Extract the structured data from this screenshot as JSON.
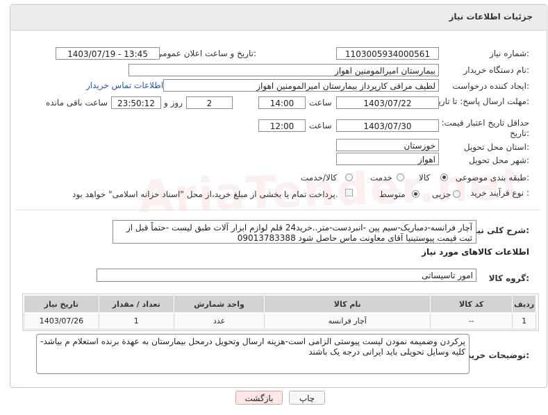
{
  "header": {
    "title": "جزئیات اطلاعات نیاز"
  },
  "watermark": "AriaTender.net",
  "fields": {
    "need_number_label": "شماره نیاز:",
    "need_number": "1103005934000561",
    "announce_label": "تاریخ و ساعت اعلان عمومی:",
    "announce_value": "1403/07/19 - 13:45",
    "buyer_org_label": "نام دستگاه خریدار:",
    "buyer_org": "بیمارستان امیرالمومنین اهواز",
    "requester_label": "ایجاد کننده درخواست:",
    "requester": "لطیف مراقی کارپرداز بیمارستان امیرالمومنین اهواز",
    "contact_link": "اطلاعات تماس خریدار",
    "deadline_label": "مهلت ارسال پاسخ: تا تاریخ:",
    "deadline_date": "1403/07/22",
    "time_label": "ساعت",
    "deadline_time": "14:00",
    "days_value": "2",
    "days_and_label": "روز و",
    "remaining_time": "23:50:12",
    "remaining_label": "ساعت باقی مانده",
    "validity_label": "حداقل تاریخ اعتبار قیمت: تا تاریخ:",
    "validity_date": "1403/07/30",
    "validity_time": "12:00",
    "province_label": "استان محل تحویل:",
    "province": "خوزستان",
    "city_label": "شهر محل تحویل:",
    "city": "اهواز",
    "category_label": "طبقه بندی موضوعی:",
    "category_options": [
      "کالا",
      "خدمت",
      "کالا/خدمت"
    ],
    "process_label": "نوع فرآیند خرید :",
    "process_options": [
      "جزیی",
      "متوسط"
    ],
    "payment_note": "پرداخت تمام یا بخشی از مبلغ خرید،از محل \"اسناد خزانه اسلامی\" خواهد بود."
  },
  "description": {
    "label": "شرح کلی نیاز:",
    "text": "آچار فرانسه-دمباریک-سیم پین -انبردست-متر..خرید24 قلم لوازم ابزار آلات  طبق لیست -حتماً قبل از ثبت قیمت پیوستینیا آقای معاونت ماس حاصل شود 09013783388"
  },
  "goods_section": {
    "title": "اطلاعات کالاهای مورد نیاز",
    "group_label": "گروه کالا:",
    "group_value": "امور تاسیساتی"
  },
  "table": {
    "headers": [
      "ردیف",
      "کد کالا",
      "نام کالا",
      "واحد شمارش",
      "تعداد / مقدار",
      "تاریخ نیاز"
    ],
    "rows": [
      [
        "1",
        "--",
        "آچار فرانسه",
        "عدد",
        "1",
        "1403/07/26"
      ]
    ]
  },
  "buyer_notes": {
    "label": "توضیحات خریدار:",
    "text": "پرکردن وضمیمه نمودن لیست پیوستی الزامی است-هزینه ارسال وتحویل درمحل بیمارستان به عهدة برنده استعلام م بیاشد- کلیه وسایل تحویلی باید ایرانی درجه یک باشند"
  },
  "buttons": {
    "print": "چاپ",
    "back": "بازگشت"
  }
}
